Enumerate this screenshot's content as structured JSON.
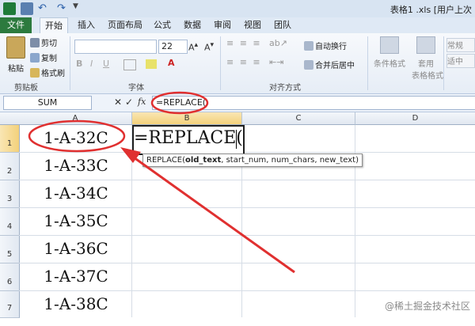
{
  "window": {
    "title": "表格1 .xls [用户上次"
  },
  "tabs": [
    "文件",
    "开始",
    "插入",
    "页面布局",
    "公式",
    "数据",
    "审阅",
    "视图",
    "团队"
  ],
  "ribbon": {
    "clipboard": {
      "paste": "粘贴",
      "cut": "剪切",
      "copy": "复制",
      "format_painter": "格式刷",
      "label": "剪贴板"
    },
    "font": {
      "size": "22",
      "label": "字体"
    },
    "alignment": {
      "wrap": "自动换行",
      "merge": "合并后居中",
      "label": "对齐方式"
    },
    "styles": {
      "conditional": "条件格式",
      "table_format": "套用",
      "table_format2": "表格格式"
    },
    "number": {
      "format": "常规",
      "label": "适中"
    }
  },
  "formula_bar": {
    "name_box": "SUM",
    "fx": "fx",
    "formula": "=REPLACE("
  },
  "grid": {
    "columns": [
      "A",
      "B",
      "C",
      "D"
    ],
    "rows": [
      "1",
      "2",
      "3",
      "4",
      "5",
      "6",
      "7"
    ],
    "cellsA": [
      "1-A-32C",
      "1-A-33C",
      "1-A-34C",
      "1-A-35C",
      "1-A-36C",
      "1-A-37C",
      "1-A-38C"
    ],
    "active_cell_text": "=REPLACE(",
    "tooltip_func": "REPLACE(",
    "tooltip_bold": "old_text",
    "tooltip_rest": ", start_num, num_chars, new_text)"
  },
  "watermark": "@稀土掘金技术社区",
  "colors": {
    "file_tab": "#2c7a3e",
    "annotation": "#e03030",
    "header_selected": "#f3d17b"
  }
}
